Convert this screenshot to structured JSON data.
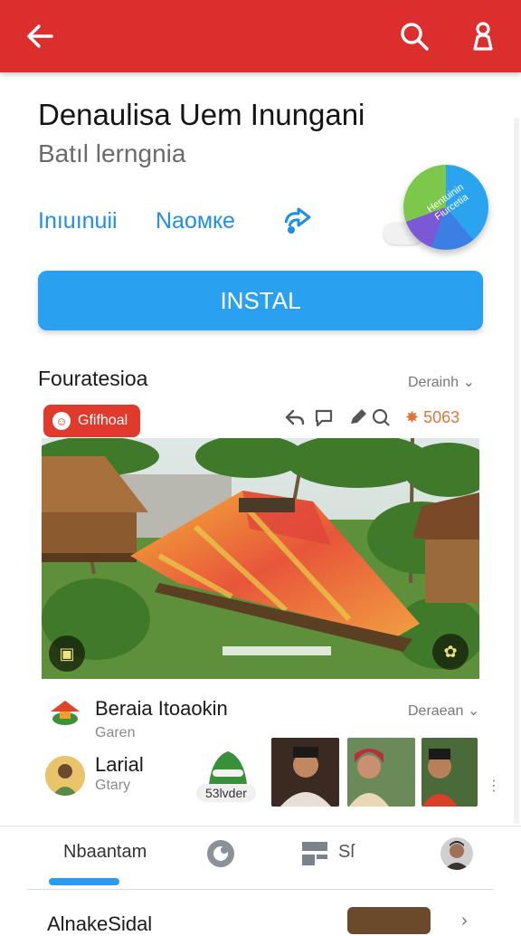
{
  "header": {
    "back_icon": "arrow-left-icon",
    "search_icon": "search-icon",
    "account_icon": "account-icon",
    "color": "#dd2e2e"
  },
  "app": {
    "title": "Denaulisa Uem Inungani",
    "subtitle": "Batıl lerngnia",
    "links": [
      "Inıuınuii",
      "Naомкe"
    ],
    "badge_text": "Hentuinin Fiurcetia",
    "install_label": "INSTAL",
    "accent": "#2aa0f0"
  },
  "section": {
    "title": "Fouratesioa",
    "dropdown": "Derainh"
  },
  "card": {
    "badge_label": "Gfifhoal",
    "rating": "5063",
    "rating_icon": "star-icon"
  },
  "rows": [
    {
      "title": "Beraia Itoaokin",
      "subtitle": "Garen",
      "dropdown": "Deraean"
    },
    {
      "title": "Larial",
      "subtitle": "Gtary",
      "chip": "53lvder"
    }
  ],
  "tabs": {
    "first_label": "Nbaantam",
    "second_label": "Sſ",
    "icons": [
      "refresh-icon",
      "news-icon",
      "profile-avatar"
    ]
  },
  "bottom": {
    "title": "AlnakeSidal"
  }
}
